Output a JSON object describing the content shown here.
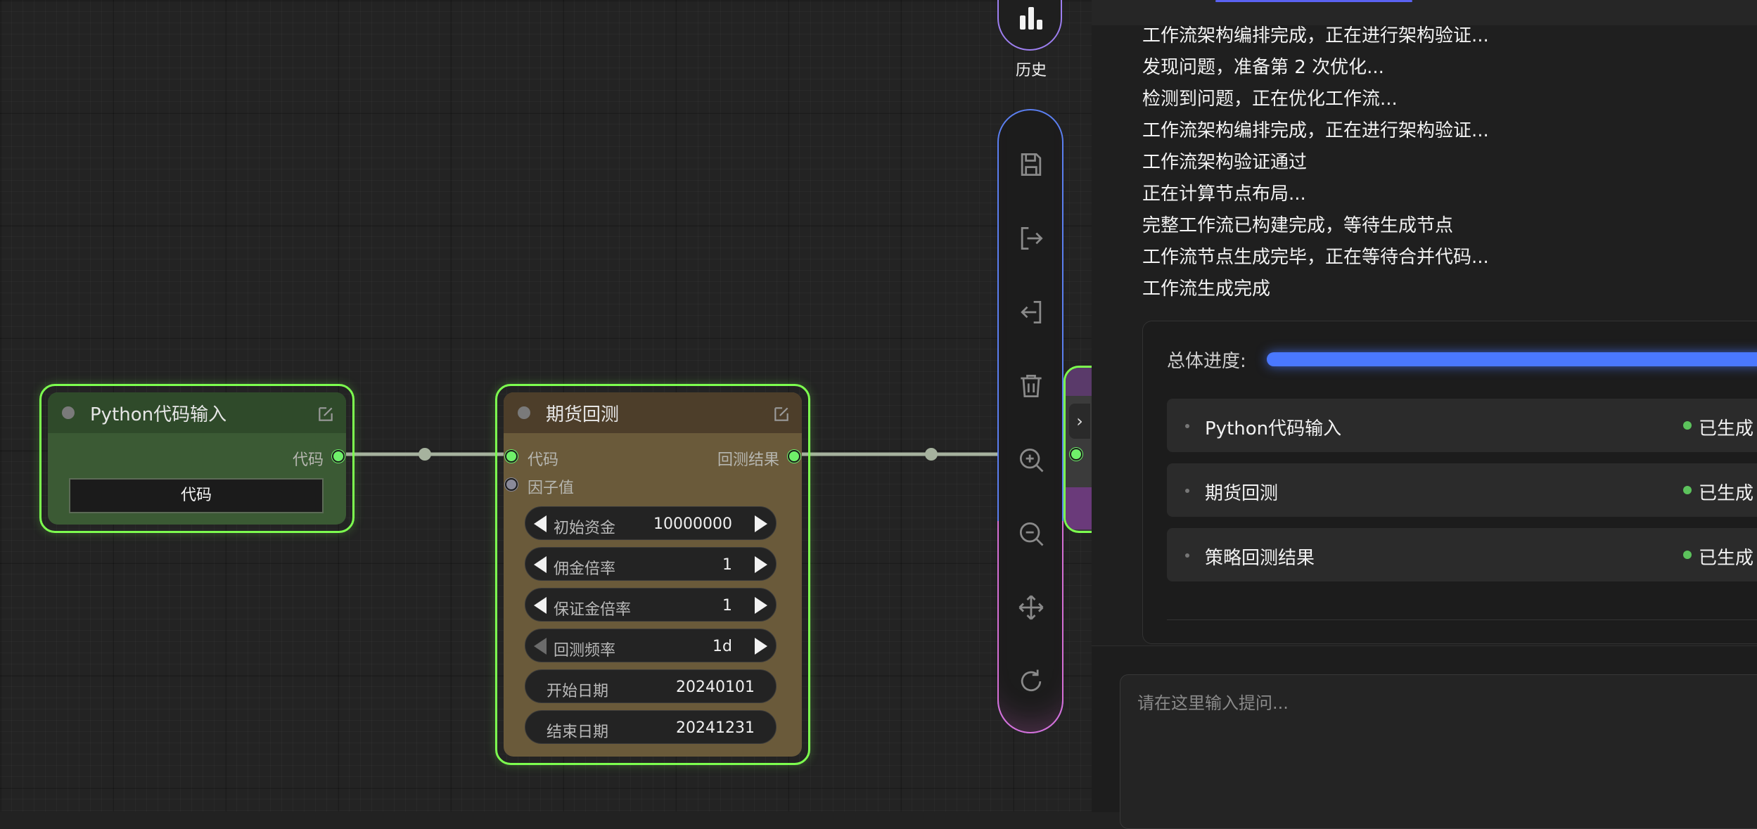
{
  "canvas": {
    "nodes": [
      {
        "title": "Python代码输入",
        "outputs": [
          "代码"
        ],
        "widget_button": "代码"
      },
      {
        "title": "期货回测",
        "inputs": [
          "代码",
          "因子值"
        ],
        "outputs": [
          "回测结果"
        ],
        "params": [
          {
            "label": "初始资金",
            "value": "10000000"
          },
          {
            "label": "佣金倍率",
            "value": "1"
          },
          {
            "label": "保证金倍率",
            "value": "1"
          },
          {
            "label": "回测频率",
            "value": "1d"
          },
          {
            "label": "开始日期",
            "value": "20240101"
          },
          {
            "label": "结束日期",
            "value": "20241231"
          }
        ]
      }
    ]
  },
  "toolbar": {
    "history_label": "历史",
    "tools": [
      "save-icon",
      "export-icon",
      "import-icon",
      "trash-icon",
      "zoom-in-icon",
      "zoom-out-icon",
      "move-icon",
      "refresh-icon"
    ]
  },
  "panel": {
    "log": [
      "工作流架构编排完成，正在进行架构验证...",
      "发现问题，准备第 2 次优化...",
      "检测到问题，正在优化工作流...",
      "工作流架构编排完成，正在进行架构验证...",
      "工作流架构验证通过",
      "正在计算节点布局...",
      "完整工作流已构建完成，等待生成节点",
      "工作流节点生成完毕，正在等待合并代码...",
      "工作流生成完成"
    ],
    "progress": {
      "label": "总体进度:",
      "value": 1.0
    },
    "steps": [
      {
        "name": "Python代码输入",
        "status": "已生成"
      },
      {
        "name": "期货回测",
        "status": "已生成"
      },
      {
        "name": "策略回测结果",
        "status": "已生成"
      }
    ],
    "input": {
      "placeholder": "请在这里输入提问..."
    }
  },
  "colors": {
    "node_border": "#7dff4f",
    "python_node_bg": "#3b5a34",
    "futures_node_bg": "#6a5a3a",
    "progress": "#4a78ff",
    "status": "#5cc25c"
  }
}
